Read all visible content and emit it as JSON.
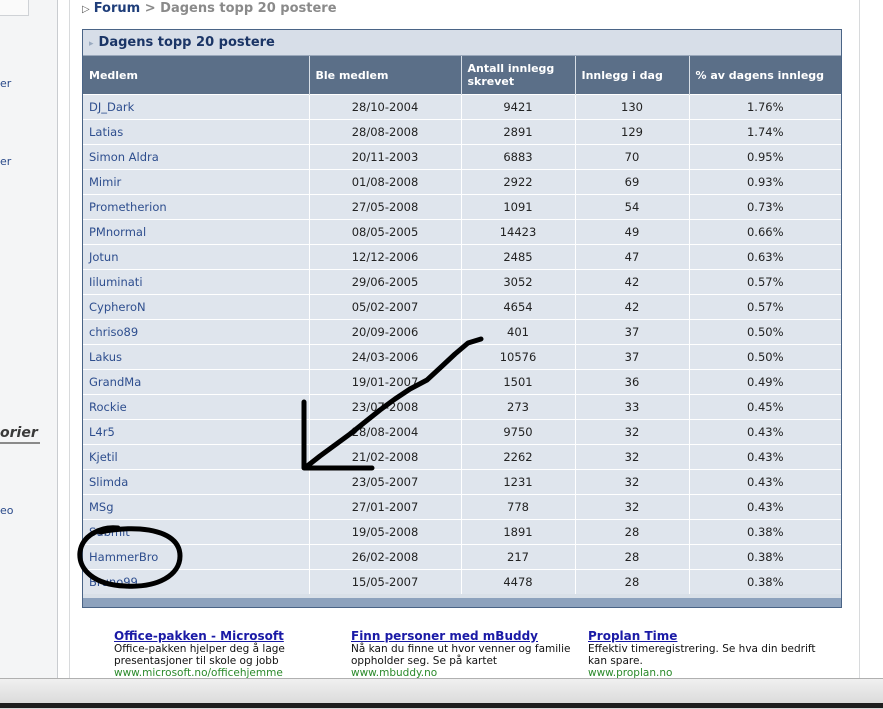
{
  "sidebar": {
    "fragments": [
      "er",
      "er",
      "orier",
      "eo"
    ]
  },
  "breadcrumb": {
    "forum": "Forum",
    "separator": ">",
    "current": "Dagens topp 20 postere"
  },
  "panel": {
    "title": "Dagens topp 20 postere",
    "columns": [
      "Medlem",
      "Ble medlem",
      "Antall innlegg skrevet",
      "Innlegg i dag",
      "% av dagens innlegg"
    ],
    "rows": [
      {
        "member": "DJ_Dark",
        "joined": "28/10-2004",
        "total": "9421",
        "today": "130",
        "percent": "1.76%"
      },
      {
        "member": "Latias",
        "joined": "28/08-2008",
        "total": "2891",
        "today": "129",
        "percent": "1.74%"
      },
      {
        "member": "Simon Aldra",
        "joined": "20/11-2003",
        "total": "6883",
        "today": "70",
        "percent": "0.95%"
      },
      {
        "member": "Mimir",
        "joined": "01/08-2008",
        "total": "2922",
        "today": "69",
        "percent": "0.93%"
      },
      {
        "member": "Prometherion",
        "joined": "27/05-2008",
        "total": "1091",
        "today": "54",
        "percent": "0.73%"
      },
      {
        "member": "PMnormal",
        "joined": "08/05-2005",
        "total": "14423",
        "today": "49",
        "percent": "0.66%"
      },
      {
        "member": "Jotun",
        "joined": "12/12-2006",
        "total": "2485",
        "today": "47",
        "percent": "0.63%"
      },
      {
        "member": "Iiluminati",
        "joined": "29/06-2005",
        "total": "3052",
        "today": "42",
        "percent": "0.57%"
      },
      {
        "member": "CypheroN",
        "joined": "05/02-2007",
        "total": "4654",
        "today": "42",
        "percent": "0.57%"
      },
      {
        "member": "chriso89",
        "joined": "20/09-2006",
        "total": "401",
        "today": "37",
        "percent": "0.50%"
      },
      {
        "member": "Lakus",
        "joined": "24/03-2006",
        "total": "10576",
        "today": "37",
        "percent": "0.50%"
      },
      {
        "member": "GrandMa",
        "joined": "19/01-2007",
        "total": "1501",
        "today": "36",
        "percent": "0.49%"
      },
      {
        "member": "Rockie",
        "joined": "23/07-2008",
        "total": "273",
        "today": "33",
        "percent": "0.45%"
      },
      {
        "member": "L4r5",
        "joined": "28/08-2004",
        "total": "9750",
        "today": "32",
        "percent": "0.43%"
      },
      {
        "member": "Kjetil",
        "joined": "21/02-2008",
        "total": "2262",
        "today": "32",
        "percent": "0.43%"
      },
      {
        "member": "Slimda",
        "joined": "23/05-2007",
        "total": "1231",
        "today": "32",
        "percent": "0.43%"
      },
      {
        "member": "MSg",
        "joined": "27/01-2007",
        "total": "778",
        "today": "32",
        "percent": "0.43%"
      },
      {
        "member": "Submit",
        "joined": "19/05-2008",
        "total": "1891",
        "today": "28",
        "percent": "0.38%"
      },
      {
        "member": "HammerBro",
        "joined": "26/02-2008",
        "total": "217",
        "today": "28",
        "percent": "0.38%"
      },
      {
        "member": "Bruno99",
        "joined": "15/05-2007",
        "total": "4478",
        "today": "28",
        "percent": "0.38%"
      }
    ]
  },
  "ads": [
    {
      "title": "Office-pakken - Microsoft",
      "text": "Office-pakken hjelper deg å lage presentasjoner til skole og jobb",
      "url": "www.microsoft.no/officehjemme"
    },
    {
      "title": "Finn personer med mBuddy",
      "text": "Nå kan du finne ut hvor venner og familie oppholder seg. Se på kartet",
      "url": "www.mbuddy.no"
    },
    {
      "title": "Proplan Time",
      "text": "Effektiv timeregistrering. Se hva din bedrift kan spare.",
      "url": "www.proplan.no"
    }
  ],
  "annotation": {
    "color": "#000000",
    "shapes": [
      "arrow",
      "circle"
    ]
  },
  "colors": {
    "header_bg": "#5b6f88",
    "row_bg": "#dfe5ed",
    "link": "#2e4e8e",
    "panel_border": "#4a6486"
  }
}
